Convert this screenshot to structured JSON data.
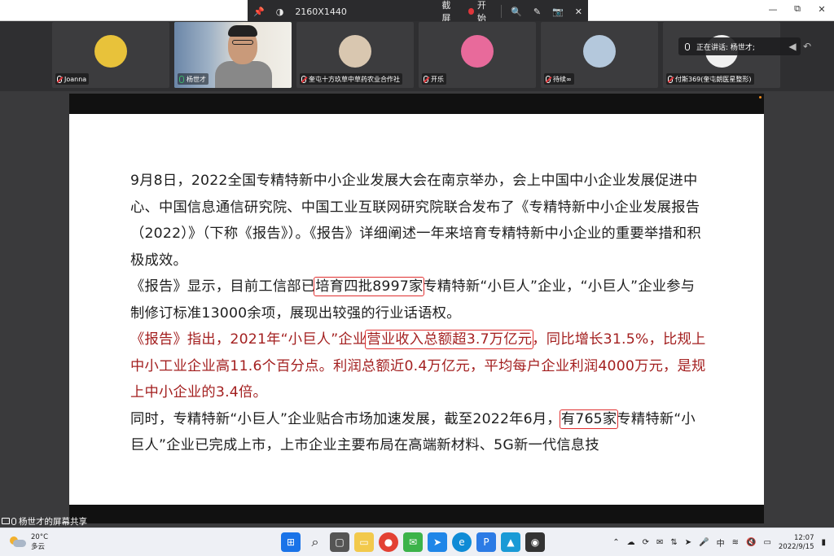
{
  "toolbar": {
    "resolution": "2160X1440",
    "screenshot_label": "截屏",
    "record_label": "开始"
  },
  "window": {
    "minimize": "—",
    "restore": "⧉",
    "close": "✕"
  },
  "participants": [
    {
      "name": "Joanna",
      "muted": true,
      "avatar_color": "#e8c23a"
    },
    {
      "name": "杨世才",
      "muted": false,
      "avatar_color": "#c99a7a"
    },
    {
      "name": "奎屯十方玖草中草药农业合作社",
      "muted": true,
      "avatar_color": "#d9c7b0"
    },
    {
      "name": "开乐",
      "muted": true,
      "avatar_color": "#e86a9b"
    },
    {
      "name": "待续∞",
      "muted": true,
      "avatar_color": "#b4c8dc"
    },
    {
      "name": "付斯369(奎屯朗医星整形)",
      "muted": true,
      "avatar_color": "#f0f0f0"
    }
  ],
  "speaking": {
    "label": "正在讲话: 杨世才;"
  },
  "document": {
    "p1": "9月8日，2022全国专精特新中小企业发展大会在南京举办，会上中国中小企业发展促进中心、中国信息通信研究院、中国工业互联网研究院联合发布了《专精特新中小企业发展报告（2022）》（下称《报告》）。《报告》详细阐述一年来培育专精特新中小企业的重要举措和积极成效。",
    "p2a": "《报告》显示，目前工信部已",
    "p2b": "培育四批8997家",
    "p2c": "专精特新“小巨人”企业，“小巨人”企业参与制修订标准13000余项，展现出较强的行业话语权。",
    "p3a": "《报告》指出，2021年“小巨人”企业",
    "p3b": "营业收入总额超3.7万亿元",
    "p3c": "，同比增长31.5%，比规上中小工业企业高11.6个百分点。利润总额近0.4万亿元，平均每户企业利润4000万元，是规上中小企业的3.4倍。",
    "p4a": "同时，专精特新“小巨人”企业贴合市场加速发展，截至2022年6月，",
    "p4b": "有765家",
    "p4c": "专精特新“小巨人”企业已完成上市，上市企业主要布局在高端新材料、5G新一代信息技"
  },
  "share_label": "杨世才的屏幕共享",
  "taskbar": {
    "temp": "20°C",
    "weather": "多云",
    "ime": "中",
    "time": "12:07",
    "date": "2022/9/15"
  }
}
